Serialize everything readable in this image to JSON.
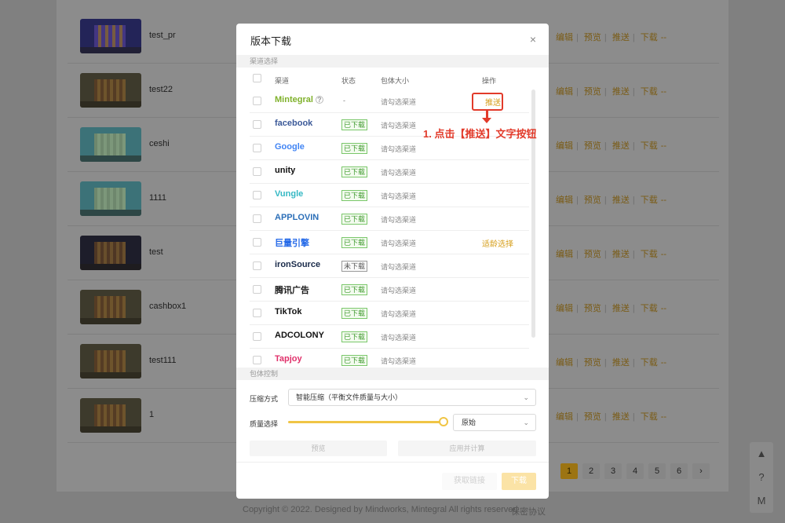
{
  "background": {
    "rows": [
      {
        "name": "test_pr",
        "thumb": "blue"
      },
      {
        "name": "test22",
        "thumb": "brown"
      },
      {
        "name": "ceshi",
        "thumb": "teal"
      },
      {
        "name": "1111",
        "thumb": "teal"
      },
      {
        "name": "test",
        "thumb": "dark"
      },
      {
        "name": "cashbox1",
        "thumb": "brown"
      },
      {
        "name": "test111",
        "thumb": "brown"
      },
      {
        "name": "1",
        "thumb": "brown"
      }
    ],
    "actions": {
      "edit": "编辑",
      "preview": "预览",
      "push": "推送",
      "download": "下载",
      "dash": "--"
    },
    "pager": [
      "1",
      "2",
      "3",
      "4",
      "5",
      "6",
      "›"
    ],
    "footer": {
      "copyright": "Copyright © 2022. Designed by Mindworks, Mintegral All rights reserved",
      "privacy": "保密协议"
    },
    "float_bar": [
      "▲",
      "?",
      "M"
    ]
  },
  "modal": {
    "title": "版本下载",
    "close": "×",
    "channel_section": "渠道选择",
    "headers": {
      "channel": "渠道",
      "status": "状态",
      "size": "包体大小",
      "operation": "操作"
    },
    "rows": [
      {
        "channel": "Mintegral",
        "status": "-",
        "status_type": "dash",
        "size": "请勾选渠道",
        "op": "推送",
        "help": true
      },
      {
        "channel": "facebook",
        "status": "已下载",
        "status_type": "ok",
        "size": "请勾选渠道",
        "op": ""
      },
      {
        "channel": "Google",
        "status": "已下载",
        "status_type": "ok",
        "size": "请勾选渠道",
        "op": ""
      },
      {
        "channel": "unity",
        "status": "已下载",
        "status_type": "ok",
        "size": "请勾选渠道",
        "op": ""
      },
      {
        "channel": "Vungle",
        "status": "已下载",
        "status_type": "ok",
        "size": "请勾选渠道",
        "op": ""
      },
      {
        "channel": "APPLOVIN",
        "status": "已下载",
        "status_type": "ok",
        "size": "请勾选渠道",
        "op": ""
      },
      {
        "channel": "巨量引擎",
        "status": "已下载",
        "status_type": "ok",
        "size": "请勾选渠道",
        "op": "适龄选择"
      },
      {
        "channel": "ironSource",
        "status": "未下载",
        "status_type": "none",
        "size": "请勾选渠道",
        "op": ""
      },
      {
        "channel": "腾讯广告",
        "status": "已下载",
        "status_type": "ok",
        "size": "请勾选渠道",
        "op": ""
      },
      {
        "channel": "TikTok",
        "status": "已下载",
        "status_type": "ok",
        "size": "请勾选渠道",
        "op": ""
      },
      {
        "channel": "ADCOLONY",
        "status": "已下载",
        "status_type": "ok",
        "size": "请勾选渠道",
        "op": ""
      },
      {
        "channel": "Tapjoy",
        "status": "已下载",
        "status_type": "ok",
        "size": "请勾选渠道",
        "op": ""
      }
    ],
    "package_section": "包体控制",
    "compress_label": "压缩方式",
    "compress_value": "智能压缩（平衡文件质量与大小）",
    "quality_label": "质量选择",
    "quality_level": 1.0,
    "quality_value": "原始",
    "preview_button": "预览",
    "apply_button": "应用并计算",
    "get_link_button": "获取链接",
    "download_button": "下载"
  },
  "annotation": {
    "text": "1. 点击【推送】文字按钮"
  },
  "colors": {
    "accent": "#d69e1a",
    "annotation": "#e23a2a",
    "downloaded": "#3f9a2e"
  }
}
